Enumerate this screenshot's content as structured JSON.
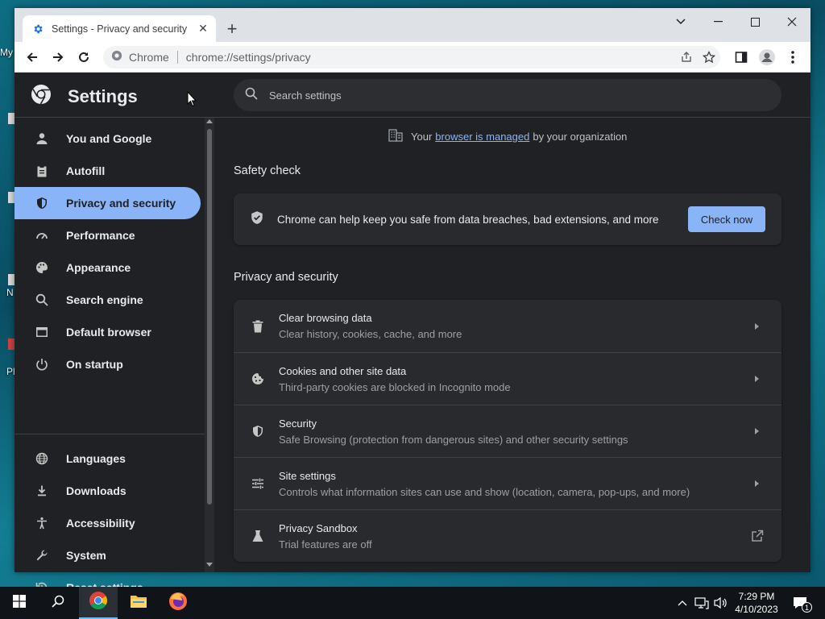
{
  "window": {
    "tab_title": "Settings - Privacy and security",
    "new_tab": "+",
    "omnibox_chip": "Chrome",
    "url": "chrome://settings/privacy"
  },
  "settings": {
    "title": "Settings",
    "search_placeholder": "Search settings",
    "nav": [
      {
        "label": "You and Google",
        "icon": "person-icon"
      },
      {
        "label": "Autofill",
        "icon": "clipboard-icon"
      },
      {
        "label": "Privacy and security",
        "icon": "shield-icon",
        "active": true
      },
      {
        "label": "Performance",
        "icon": "speedometer-icon"
      },
      {
        "label": "Appearance",
        "icon": "palette-icon"
      },
      {
        "label": "Search engine",
        "icon": "search-icon"
      },
      {
        "label": "Default browser",
        "icon": "browser-icon"
      },
      {
        "label": "On startup",
        "icon": "power-icon"
      },
      {
        "label": "Languages",
        "icon": "globe-icon"
      },
      {
        "label": "Downloads",
        "icon": "download-icon"
      },
      {
        "label": "Accessibility",
        "icon": "accessibility-icon"
      },
      {
        "label": "System",
        "icon": "wrench-icon"
      },
      {
        "label": "Reset settings",
        "icon": "history-icon"
      }
    ],
    "managed_prefix": "Your",
    "managed_link": "browser is managed",
    "managed_suffix": "by your organization",
    "safety_check": {
      "heading": "Safety check",
      "text": "Chrome can help keep you safe from data breaches, bad extensions, and more",
      "button": "Check now"
    },
    "privacy": {
      "heading": "Privacy and security",
      "rows": [
        {
          "title": "Clear browsing data",
          "subtitle": "Clear history, cookies, cache, and more"
        },
        {
          "title": "Cookies and other site data",
          "subtitle": "Third-party cookies are blocked in Incognito mode"
        },
        {
          "title": "Security",
          "subtitle": "Safe Browsing (protection from dangerous sites) and other security settings"
        },
        {
          "title": "Site settings",
          "subtitle": "Controls what information sites can use and show (location, camera, pop-ups, and more)"
        },
        {
          "title": "Privacy Sandbox",
          "subtitle": "Trial features are off"
        }
      ]
    }
  },
  "taskbar": {
    "time": "7:29 PM",
    "date": "4/10/2023",
    "notification_count": "1"
  },
  "desktop": {
    "fragments": [
      "My",
      "N",
      "Pl"
    ]
  },
  "colors": {
    "accent": "#8ab4f8",
    "background": "#202124",
    "card": "#292a2d"
  }
}
